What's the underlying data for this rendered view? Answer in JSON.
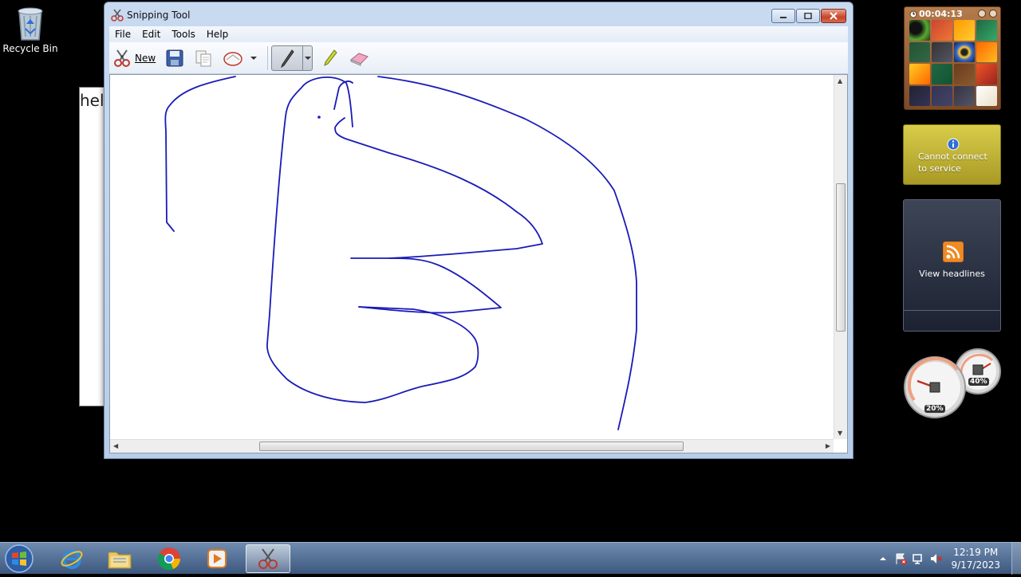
{
  "desktop": {
    "recycle_bin_label": "Recycle Bin",
    "background_window_text": "hel"
  },
  "window": {
    "title": "Snipping Tool",
    "menu": [
      "File",
      "Edit",
      "Tools",
      "Help"
    ],
    "toolbar": {
      "new_label": "New",
      "tools": [
        "save-icon",
        "copy-icon",
        "send-snip-icon",
        "pen-icon",
        "highlighter-icon",
        "eraser-icon"
      ]
    },
    "stroke_color": "#1a1ab8"
  },
  "gadgets": {
    "puzzle_timer": "00:04:13",
    "weather_message_line1": "Cannot connect",
    "weather_message_line2": "to service",
    "feed_message": "View headlines",
    "cpu_percent": "20%",
    "memory_percent": "40%"
  },
  "taskbar": {
    "apps": [
      "internet-explorer",
      "windows-explorer",
      "google-chrome",
      "media-player",
      "snipping-tool"
    ],
    "active_app": "snipping-tool",
    "clock_time": "12:19 PM",
    "clock_date": "9/17/2023"
  }
}
